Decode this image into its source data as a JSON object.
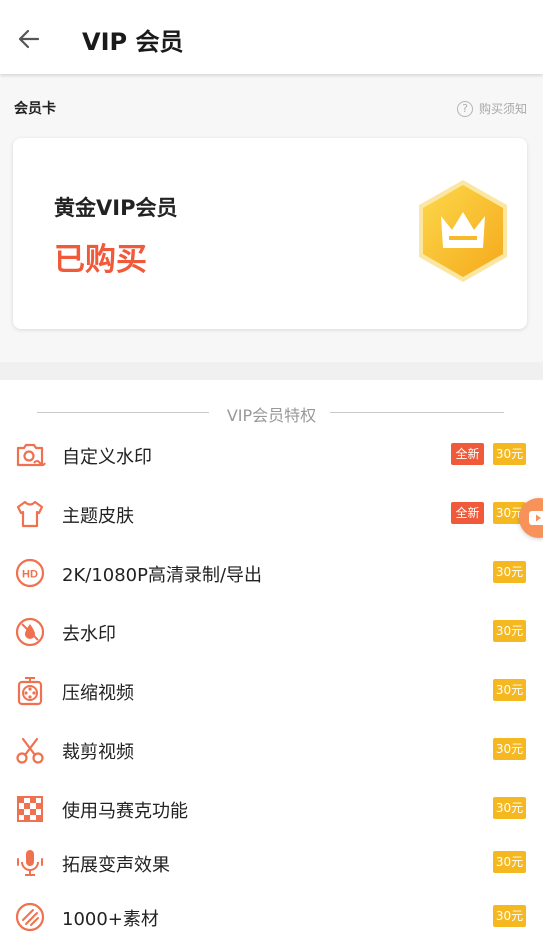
{
  "header": {
    "title": "VIP 会员",
    "back_icon": "arrow-left-icon"
  },
  "card_section": {
    "title": "会员卡",
    "notice_label": "购买须知",
    "notice_icon": "question-circle-icon",
    "card": {
      "name": "黄金VIP会员",
      "status": "已购买",
      "badge_icon": "crown-hexagon-icon"
    }
  },
  "benefits": {
    "title": "VIP会员特权",
    "new_label": "全新",
    "items": [
      {
        "label": "自定义水印",
        "icon": "camera-watermark-icon",
        "is_new": true,
        "price": "30元"
      },
      {
        "label": "主题皮肤",
        "icon": "tshirt-icon",
        "is_new": true,
        "price": "30元"
      },
      {
        "label": "2K/1080P高清录制/导出",
        "icon": "hd-icon",
        "is_new": false,
        "price": "30元"
      },
      {
        "label": "去水印",
        "icon": "drop-slash-icon",
        "is_new": false,
        "price": "30元"
      },
      {
        "label": "压缩视频",
        "icon": "film-reel-compress-icon",
        "is_new": false,
        "price": "30元"
      },
      {
        "label": "裁剪视频",
        "icon": "scissors-icon",
        "is_new": false,
        "price": "30元"
      },
      {
        "label": "使用马赛克功能",
        "icon": "mosaic-icon",
        "is_new": false,
        "price": "30元"
      },
      {
        "label": "拓展变声效果",
        "icon": "microphone-icon",
        "is_new": false,
        "price": "30元"
      },
      {
        "label": "1000+素材",
        "icon": "material-pack-icon",
        "is_new": false,
        "price": "30元"
      }
    ]
  },
  "floating_button": {
    "icon": "video-play-icon"
  },
  "colors": {
    "accent": "#f0593a",
    "price": "#f6b820",
    "icon": "#f0714f",
    "gold": "#f8c630"
  }
}
